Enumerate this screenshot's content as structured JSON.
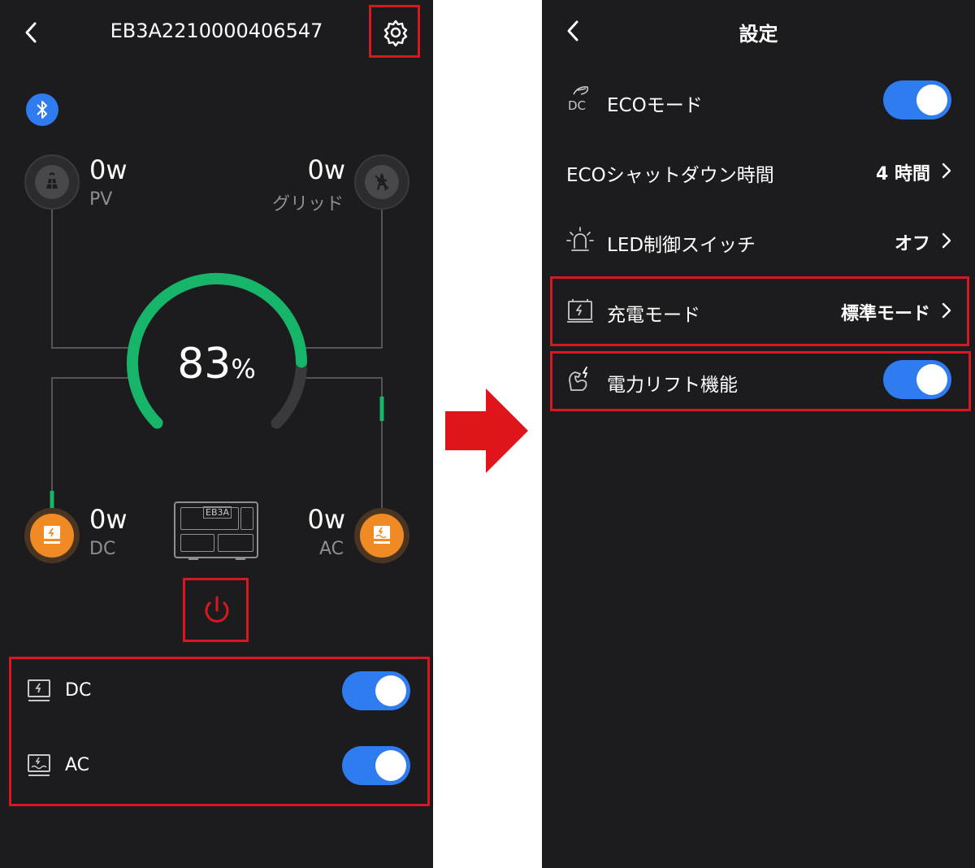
{
  "left_screen": {
    "device_id": "EB3A2210000406547",
    "battery_percent": "83",
    "battery_percent_unit": "%",
    "battery_level": 0.83,
    "pv": {
      "value": "0w",
      "label": "PV"
    },
    "grid": {
      "value": "0w",
      "label": "グリッド"
    },
    "dc": {
      "value": "0w",
      "label": "DC"
    },
    "ac": {
      "value": "0w",
      "label": "AC"
    },
    "device_badge": "EB3A",
    "outputs": [
      {
        "label": "DC",
        "on": true
      },
      {
        "label": "AC",
        "on": true
      }
    ]
  },
  "right_screen": {
    "title": "設定",
    "items": [
      {
        "label": "ECOモード",
        "icon": "eco-dc-icon",
        "type": "toggle",
        "on": true
      },
      {
        "label": "ECOシャットダウン時間",
        "value": "4 時間",
        "type": "link"
      },
      {
        "label": "LED制御スイッチ",
        "icon": "led-light-icon",
        "value": "オフ",
        "type": "link"
      },
      {
        "label": "充電モード",
        "icon": "charge-mode-icon",
        "value": "標準モード",
        "type": "link"
      },
      {
        "label": "電力リフト機能",
        "icon": "power-lift-icon",
        "type": "toggle",
        "on": true
      }
    ]
  },
  "colors": {
    "background": "#1c1c1e",
    "accent_green": "#16b569",
    "toggle_blue": "#2f7bf0",
    "orange": "#f08a24",
    "highlight_red": "#d8171e",
    "arrow_red": "#e0151c"
  }
}
